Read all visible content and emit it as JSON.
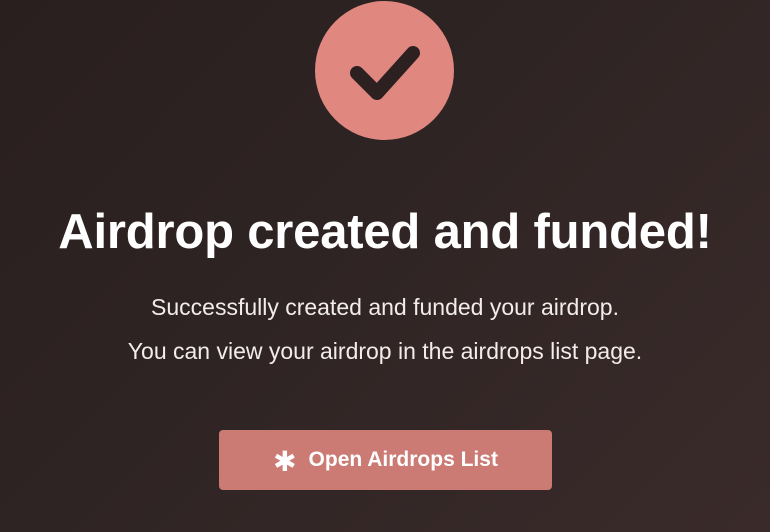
{
  "success": {
    "icon": "checkmark-icon",
    "title": "Airdrop created and funded!",
    "description_line1": "Successfully created and funded your airdrop.",
    "description_line2": "You can view your airdrop in the airdrops list page."
  },
  "action": {
    "icon": "asterisk-icon",
    "icon_glyph": "✱",
    "label": "Open Airdrops List"
  },
  "colors": {
    "accent": "#e08880",
    "button": "#cb7a74",
    "background": "#2f2424",
    "check": "#2d2020"
  }
}
